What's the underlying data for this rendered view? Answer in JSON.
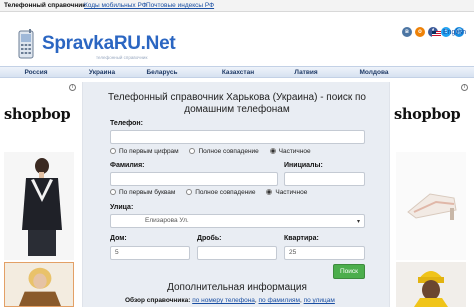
{
  "topbar": {
    "title": "Телефонный справочник",
    "link_mobile": "Коды мобильных РФ",
    "link_postal": "Почтовые индексы РФ"
  },
  "logo": {
    "name": "SpravkaRU.Net",
    "subtitle": "телефонный справочник"
  },
  "social": [
    {
      "name": "vk",
      "color": "#4c75a3",
      "glyph": "в"
    },
    {
      "name": "odnoklassniki",
      "color": "#ee8208",
      "glyph": "о"
    },
    {
      "name": "facebook",
      "color": "#3b5998",
      "glyph": "f"
    },
    {
      "name": "twitter",
      "color": "#1da1f2",
      "glyph": "t"
    },
    {
      "name": "mail",
      "color": "#168de2",
      "glyph": "@"
    }
  ],
  "language": {
    "label": "English"
  },
  "nav": [
    "Россия",
    "Украина",
    "Беларусь",
    "Казахстан",
    "Латвия",
    "Молдова"
  ],
  "ads": {
    "brand": "shopbop",
    "info_glyph": "i"
  },
  "form": {
    "title": "Телефонный справочник Харькова (Украина) - поиск по домашним телефонам",
    "phone_label": "Телефон:",
    "phone_value": "",
    "phone_options": [
      "По первым цифрам",
      "Полное совпадение",
      "Частичное"
    ],
    "phone_selected": 2,
    "surname_label": "Фамилия:",
    "initials_label": "Инициалы:",
    "name_options": [
      "По первым буквам",
      "Полное совпадение",
      "Частичное"
    ],
    "name_selected": 2,
    "street_label": "Улица:",
    "street_value": "Елизарова Ул.",
    "house_label": "Дом:",
    "house_value": "5",
    "fraction_label": "Дробь:",
    "fraction_value": "",
    "apt_label": "Квартира:",
    "apt_value": "25",
    "search_button": "Поиск"
  },
  "extra": {
    "title": "Дополнительная информация",
    "overview_label": "Обзор справочника:",
    "overview_links": [
      "по номеру телефона",
      "по фамилиям",
      "по улицам"
    ]
  }
}
